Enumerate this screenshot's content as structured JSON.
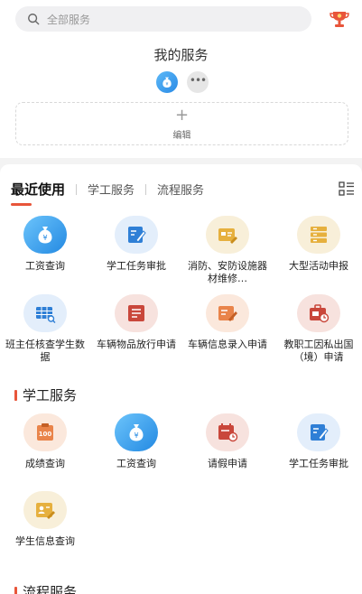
{
  "search": {
    "placeholder": "全部服务"
  },
  "my_services": {
    "title": "我的服务",
    "edit_plus": "+",
    "edit_label": "编辑"
  },
  "tabs": [
    {
      "label": "最近使用"
    },
    {
      "label": "学工服务"
    },
    {
      "label": "流程服务"
    }
  ],
  "recent": [
    {
      "label": "工资查询",
      "icon": "money-bag-icon"
    },
    {
      "label": "学工任务审批",
      "icon": "approval-pen-icon"
    },
    {
      "label": "消防、安防设施器材维修…",
      "icon": "card-edit-icon"
    },
    {
      "label": "大型活动申报",
      "icon": "stack-list-icon"
    },
    {
      "label": "班主任核查学生数据",
      "icon": "data-table-icon"
    },
    {
      "label": "车辆物品放行申请",
      "icon": "document-icon"
    },
    {
      "label": "车辆信息录入申请",
      "icon": "form-edit-icon"
    },
    {
      "label": "教职工因私出国（境）申请",
      "icon": "briefcase-clock-icon"
    }
  ],
  "xuegong": {
    "title": "学工服务",
    "items": [
      {
        "label": "成绩查询",
        "icon": "score-100-icon"
      },
      {
        "label": "工资查询",
        "icon": "money-bag-icon"
      },
      {
        "label": "请假申请",
        "icon": "calendar-clock-icon"
      },
      {
        "label": "学工任务审批",
        "icon": "approval-pen-icon"
      },
      {
        "label": "学生信息查询",
        "icon": "student-card-icon"
      }
    ]
  },
  "liucheng": {
    "title": "流程服务"
  },
  "colors": {
    "accent": "#e8553a",
    "blue": "#2389e2",
    "yellow": "#e6b03e",
    "red": "#c9473b",
    "orange": "#e9844a"
  }
}
